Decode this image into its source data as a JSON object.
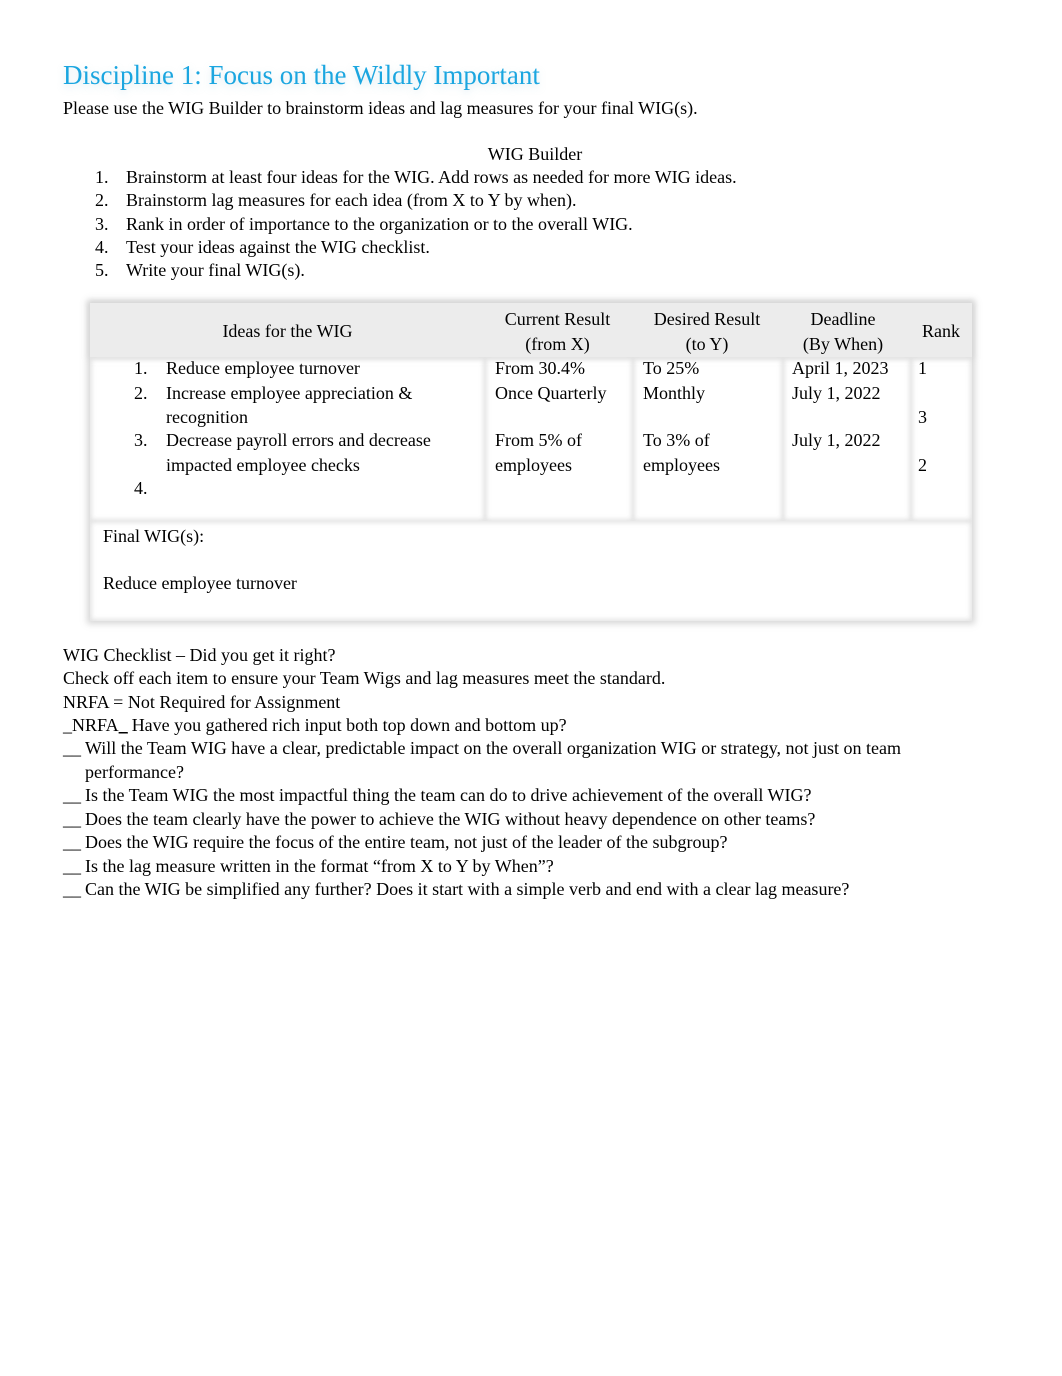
{
  "heading": "Discipline 1: Focus on the Wildly Important",
  "intro": "Please use the WIG Builder to brainstorm ideas and lag measures for your final WIG(s).",
  "builder": {
    "title": "WIG Builder",
    "steps": [
      {
        "num": "1.",
        "text": "Brainstorm at least four ideas for the WIG. Add rows as needed for more WIG ideas."
      },
      {
        "num": "2.",
        "text": "Brainstorm lag measures for each idea (from X to Y by when)."
      },
      {
        "num": "3.",
        "text": "Rank in order of importance to the organization or to the overall WIG."
      },
      {
        "num": "4.",
        "text": "Test your ideas against the WIG checklist."
      },
      {
        "num": "5.",
        "text": "Write your final WIG(s)."
      }
    ]
  },
  "table": {
    "headers": {
      "idea": "Ideas for the WIG",
      "current_1": "Current Result",
      "current_2": "(from X)",
      "desired_1": "Desired Result",
      "desired_2": "(to Y)",
      "deadline_1": "Deadline",
      "deadline_2": "(By When)",
      "rank": "Rank"
    },
    "rows": [
      {
        "num": "1.",
        "idea_1": "Reduce employee turnover",
        "idea_2": "",
        "current_1": "From 30.4%",
        "current_2": "",
        "desired_1": "To 25%",
        "desired_2": "",
        "deadline": "April 1, 2023",
        "rank": "1"
      },
      {
        "num": "2.",
        "idea_1": "Increase employee appreciation &",
        "idea_2": "recognition",
        "current_1": "Once Quarterly",
        "current_2": "",
        "desired_1": "Monthly",
        "desired_2": "",
        "deadline": "July 1, 2022",
        "rank": "3"
      },
      {
        "num": "3.",
        "idea_1": "Decrease payroll errors and decrease",
        "idea_2": "impacted employee checks",
        "current_1": "From 5% of",
        "current_2": "employees",
        "desired_1": "To 3% of",
        "desired_2": "employees",
        "deadline": "July 1, 2022",
        "rank": "2"
      },
      {
        "num": "4.",
        "idea_1": "",
        "idea_2": "",
        "current_1": "",
        "current_2": "",
        "desired_1": "",
        "desired_2": "",
        "deadline": "",
        "rank": ""
      }
    ],
    "final_label": "Final WIG(s):",
    "final_value": "Reduce employee turnover"
  },
  "checklist": {
    "title": "WIG Checklist – Did you get it right?",
    "instruction": "Check off each item to ensure your Team Wigs and lag measures meet the standard.",
    "legend": "NRFA = Not Required for Assignment",
    "items": [
      {
        "mark_prefix": "_",
        "mark": "NRFA",
        "mark_suffix": "_",
        "text": "Have you gathered rich input both top down and bottom up?"
      },
      {
        "mark_prefix": "__",
        "mark": "",
        "mark_suffix": "",
        "text": "Will the Team WIG have a clear, predictable impact on the overall organization WIG or strategy, not just on team performance?"
      },
      {
        "mark_prefix": "__",
        "mark": "",
        "mark_suffix": "",
        "text": "Is the Team WIG the most impactful thing the team can do to drive achievement of the overall WIG?"
      },
      {
        "mark_prefix": "__",
        "mark": "",
        "mark_suffix": "",
        "text": "Does the team clearly have the power to achieve the WIG without heavy dependence on other teams?"
      },
      {
        "mark_prefix": "__",
        "mark": "",
        "mark_suffix": "",
        "text": "Does the WIG require the focus of the entire team, not just of the leader of the subgroup?"
      },
      {
        "mark_prefix": "__",
        "mark": "",
        "mark_suffix": "",
        "text": "Is the lag measure written in the format “from X to Y by When”?"
      },
      {
        "mark_prefix": "__",
        "mark": "",
        "mark_suffix": "",
        "text": "Can the WIG be simplified any further? Does it start with a simple verb and end with a clear lag measure?"
      }
    ]
  }
}
